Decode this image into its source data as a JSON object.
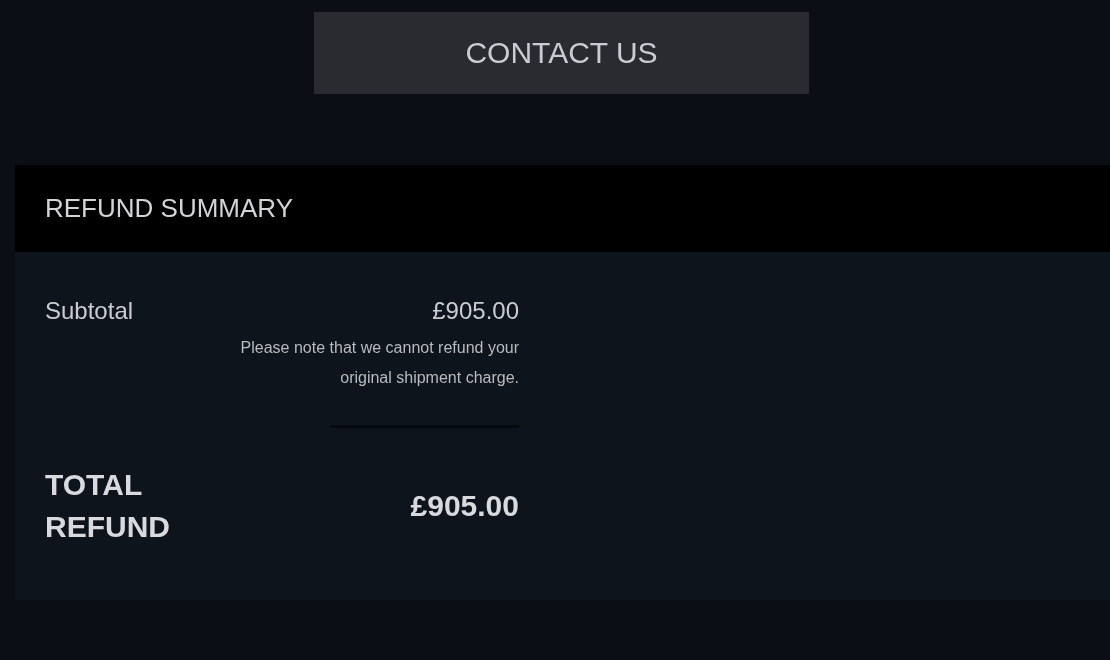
{
  "contact_button": {
    "label": "CONTACT US"
  },
  "refund_summary": {
    "title": "REFUND SUMMARY",
    "subtotal": {
      "label": "Subtotal",
      "value": "£905.00"
    },
    "note": "Please note that we cannot refund your original shipment charge.",
    "total": {
      "label": "TOTAL REFUND",
      "value": "£905.00"
    }
  }
}
